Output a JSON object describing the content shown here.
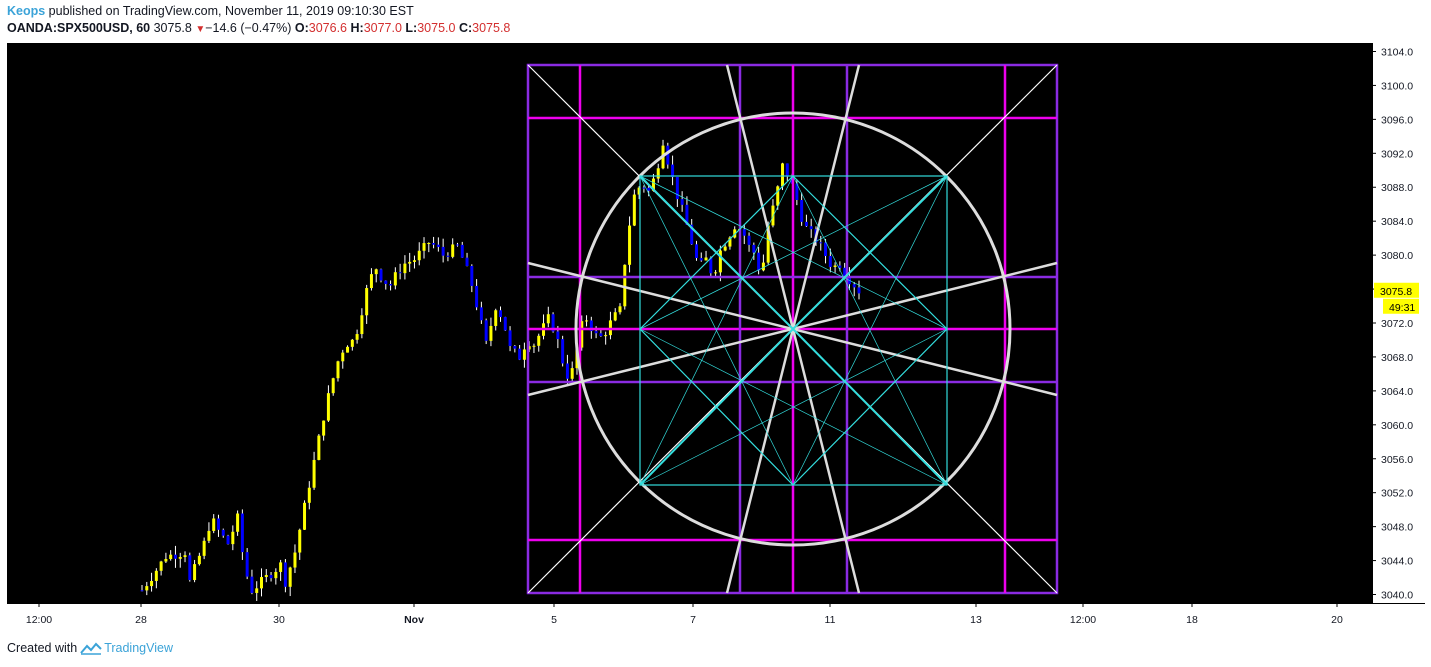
{
  "header": {
    "author": "Keops",
    "published_text": " published on TradingView.com, November 11, 2019 09:10:30 EST",
    "symbol": "OANDA:SPX500USD, 60",
    "last": "3075.8",
    "change": "−14.6 (−0.47%)",
    "o_label": "O:",
    "o": "3076.6",
    "h_label": "H:",
    "h": "3077.0",
    "l_label": "L:",
    "l": "3075.0",
    "c_label": "C:",
    "c": "3075.8"
  },
  "price_axis": {
    "ticks": [
      "3104.0",
      "3100.0",
      "3096.0",
      "3092.0",
      "3088.0",
      "3084.0",
      "3080.0",
      "3076.0",
      "3072.0",
      "3068.0",
      "3064.0",
      "3060.0",
      "3056.0",
      "3052.0",
      "3048.0",
      "3044.0",
      "3040.0"
    ],
    "current_price": "3075.8",
    "countdown": "49:31"
  },
  "time_axis": {
    "ticks": [
      "12:00",
      "28",
      "30",
      "Nov",
      "5",
      "7",
      "11",
      "13",
      "12:00",
      "18",
      "20"
    ]
  },
  "footer": {
    "created_with": "Created with",
    "brand": "TradingView"
  },
  "colors": {
    "background": "#000000",
    "candle_up": "#ffff00",
    "candle_down": "#0000ff",
    "wick": "#ffffff",
    "box_purple": "#8a2be2",
    "box_magenta": "#ee00ee",
    "circle": "#dddddd",
    "diagonals": "#ffffff",
    "inner_geometry": "#33dddd",
    "price_label": "#ffff00"
  },
  "chart_data": {
    "type": "candlestick",
    "symbol": "OANDA:SPX500USD",
    "interval": "60",
    "ylim": [
      3039,
      3105
    ],
    "x_tick_labels": [
      "12:00",
      "28",
      "30",
      "Nov",
      "5",
      "7",
      "11",
      "13",
      "12:00",
      "18",
      "20"
    ],
    "last_price": 3075.8,
    "price_path": [
      [
        0,
        3040.5
      ],
      [
        0.5,
        3044.5
      ],
      [
        0.9,
        3045.0
      ],
      [
        1.0,
        3041.5
      ],
      [
        1.3,
        3046.0
      ],
      [
        1.45,
        3049.0
      ],
      [
        1.6,
        3047.5
      ],
      [
        1.8,
        3046.0
      ],
      [
        2.0,
        3049.0
      ],
      [
        2.15,
        3043.0
      ],
      [
        2.3,
        3040.5
      ],
      [
        2.7,
        3042.5
      ],
      [
        2.9,
        3043.5
      ],
      [
        3.0,
        3041.5
      ],
      [
        3.2,
        3045.0
      ],
      [
        3.35,
        3049.0
      ],
      [
        3.5,
        3053.0
      ],
      [
        3.65,
        3057.0
      ],
      [
        3.8,
        3061.0
      ],
      [
        3.95,
        3064.5
      ],
      [
        4.1,
        3067.5
      ],
      [
        4.25,
        3069.5
      ],
      [
        4.45,
        3070.0
      ],
      [
        4.6,
        3073.5
      ],
      [
        4.75,
        3077.0
      ],
      [
        4.9,
        3078.5
      ],
      [
        5.05,
        3077.0
      ],
      [
        5.2,
        3076.5
      ],
      [
        5.35,
        3078.0
      ],
      [
        5.5,
        3079.0
      ],
      [
        5.7,
        3079.5
      ],
      [
        5.85,
        3080.5
      ],
      [
        6.0,
        3081.5
      ],
      [
        6.15,
        3081.0
      ],
      [
        6.3,
        3080.0
      ],
      [
        6.45,
        3080.5
      ],
      [
        6.6,
        3081.0
      ],
      [
        6.75,
        3079.0
      ],
      [
        6.9,
        3076.5
      ],
      [
        7.05,
        3073.0
      ],
      [
        7.2,
        3069.5
      ],
      [
        7.4,
        3074.0
      ],
      [
        7.55,
        3072.5
      ],
      [
        7.7,
        3069.0
      ],
      [
        7.9,
        3068.0
      ],
      [
        8.05,
        3070.0
      ],
      [
        8.2,
        3069.5
      ],
      [
        8.35,
        3071.0
      ],
      [
        8.5,
        3072.5
      ],
      [
        8.65,
        3071.0
      ],
      [
        8.8,
        3067.5
      ],
      [
        8.95,
        3065.0
      ],
      [
        9.1,
        3069.0
      ],
      [
        9.25,
        3073.0
      ],
      [
        9.4,
        3071.5
      ],
      [
        9.55,
        3070.0
      ],
      [
        9.7,
        3071.0
      ],
      [
        9.85,
        3072.5
      ],
      [
        10.0,
        3073.5
      ],
      [
        10.15,
        3082.0
      ],
      [
        10.3,
        3087.0
      ],
      [
        10.45,
        3088.5
      ],
      [
        10.6,
        3087.5
      ],
      [
        10.75,
        3089.5
      ],
      [
        10.9,
        3093.5
      ],
      [
        11.05,
        3090.0
      ],
      [
        11.2,
        3087.0
      ],
      [
        11.35,
        3084.5
      ],
      [
        11.5,
        3081.5
      ],
      [
        11.65,
        3078.5
      ],
      [
        11.8,
        3079.5
      ],
      [
        11.95,
        3077.5
      ],
      [
        12.1,
        3080.5
      ],
      [
        12.25,
        3082.0
      ],
      [
        12.4,
        3083.5
      ],
      [
        12.55,
        3083.0
      ],
      [
        12.7,
        3081.0
      ],
      [
        12.85,
        3080.0
      ],
      [
        12.95,
        3077.0
      ],
      [
        13.1,
        3083.5
      ],
      [
        13.25,
        3086.5
      ],
      [
        13.4,
        3090.5
      ],
      [
        13.55,
        3089.0
      ],
      [
        13.7,
        3086.5
      ],
      [
        13.85,
        3083.5
      ],
      [
        14.0,
        3082.5
      ],
      [
        14.15,
        3081.5
      ],
      [
        14.3,
        3080.0
      ],
      [
        14.45,
        3078.5
      ],
      [
        14.6,
        3079.0
      ],
      [
        14.75,
        3077.5
      ],
      [
        14.9,
        3076.5
      ],
      [
        15.0,
        3075.8
      ]
    ]
  }
}
